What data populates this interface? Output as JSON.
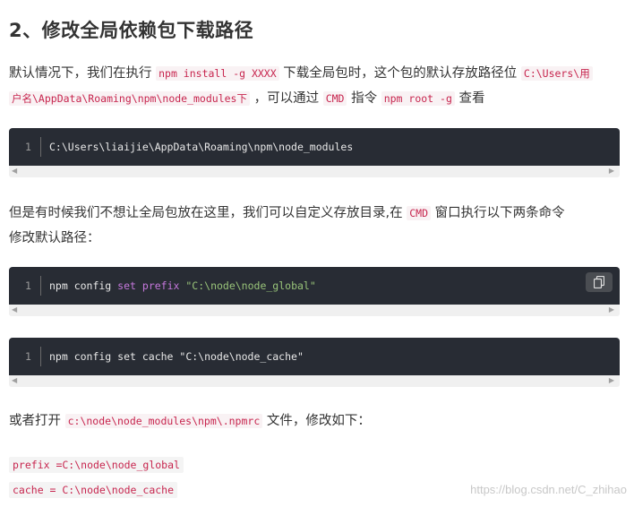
{
  "heading": "2、修改全局依赖包下载路径",
  "p1": {
    "t1": "默认情况下，我们在执行 ",
    "c1": "npm install -g XXXX",
    "t2": " 下载全局包时，这个包的默认存放路径位 ",
    "c2a": "C:\\Users\\用",
    "c2b": "户名\\AppData\\Roaming\\npm\\node_modules下",
    "t3": " ，可以通过 ",
    "c3": "CMD",
    "t4": " 指令 ",
    "c4": "npm root -g",
    "t5": " 查看"
  },
  "block1": {
    "line": "1",
    "code": "C:\\Users\\liaijie\\AppData\\Roaming\\npm\\node_modules"
  },
  "p2": {
    "t1": "但是有时候我们不想让全局包放在这里，我们可以自定义存放目录,在 ",
    "c1": "CMD",
    "t2": " 窗口执行以下两条命令",
    "t3": "修改默认路径："
  },
  "block2": {
    "line": "1",
    "cmd": "npm config ",
    "kw1": "set",
    "kw2": "prefix",
    "str": "\"C:\\node\\node_global\""
  },
  "block3": {
    "line": "1",
    "code": "npm config set cache \"C:\\node\\node_cache\""
  },
  "p3": {
    "t1": "或者打开 ",
    "c1": "c:\\node\\node_modules\\npm\\.npmrc",
    "t2": " 文件，修改如下："
  },
  "cfg1": "prefix =C:\\node\\node_global",
  "cfg2": "cache = C:\\node\\node_cache",
  "watermark": "https://blog.csdn.net/C_zhihao"
}
